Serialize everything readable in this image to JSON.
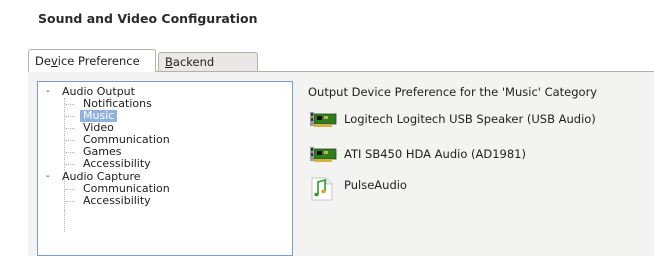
{
  "window": {
    "title": "Sound and Video Configuration"
  },
  "tabs": [
    {
      "label": "Device Preference",
      "active": true
    },
    {
      "label": "Backend",
      "active": false
    }
  ],
  "tree": {
    "groups": [
      {
        "label": "Audio Output",
        "expanded_symbol": "-",
        "items": [
          "Notifications",
          "Music",
          "Video",
          "Communication",
          "Games",
          "Accessibility"
        ]
      },
      {
        "label": "Audio Capture",
        "expanded_symbol": "-",
        "items": [
          "Communication",
          "Accessibility"
        ]
      }
    ],
    "selected": "Music"
  },
  "right_panel": {
    "header": "Output Device Preference for the 'Music' Category",
    "devices": [
      {
        "label": "Logitech Logitech USB Speaker (USB Audio)",
        "icon": "sound-card-icon"
      },
      {
        "label": "ATI SB450 HDA Audio (AD1981)",
        "icon": "sound-card-icon"
      },
      {
        "label": "PulseAudio",
        "icon": "music-note-icon"
      }
    ]
  },
  "colors": {
    "selection": "#8fb1de",
    "tree_border": "#7d9bc8",
    "card_green": "#2f7d1f"
  }
}
